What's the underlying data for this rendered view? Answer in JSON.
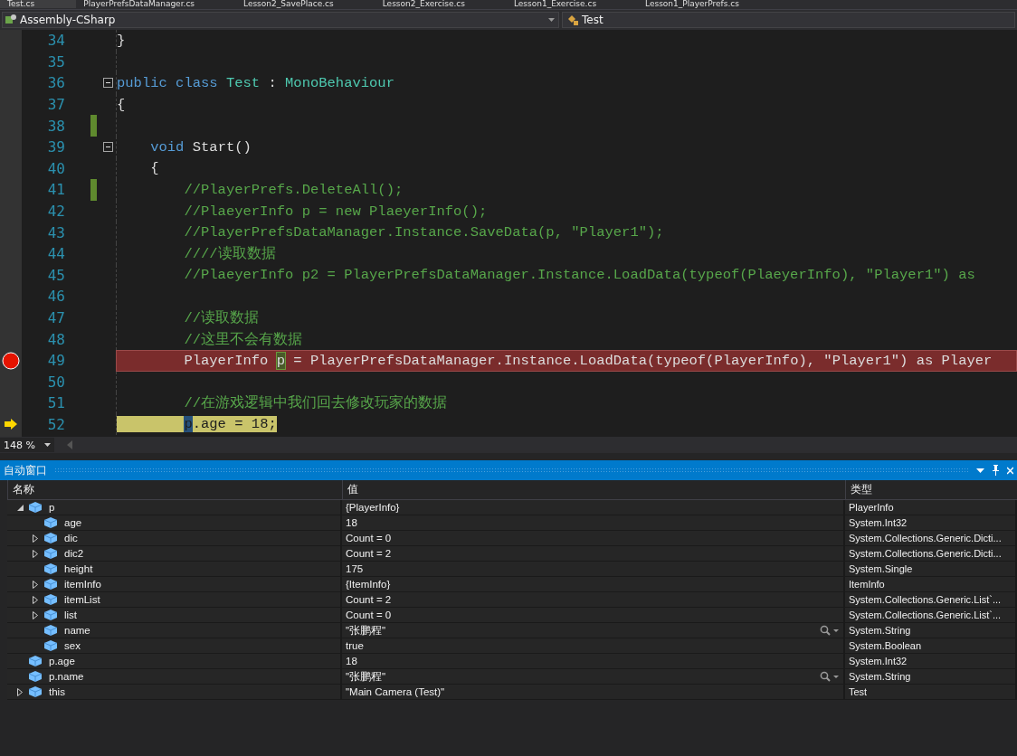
{
  "tabs": [
    {
      "label": "Test.cs",
      "selected": true
    },
    {
      "label": "PlayerPrefsDataManager.cs",
      "selected": false
    },
    {
      "label": "Lesson2_SavePlace.cs",
      "selected": false
    },
    {
      "label": "Lesson2_Exercise.cs",
      "selected": false
    },
    {
      "label": "Lesson1_Exercise.cs",
      "selected": false
    },
    {
      "label": "Lesson1_PlayerPrefs.cs",
      "selected": false
    }
  ],
  "navbar": {
    "project": "Assembly-CSharp",
    "class": "Test"
  },
  "editor": {
    "lines": [
      {
        "number": "34",
        "tokens": [
          {
            "kind": "plain",
            "text": "}"
          }
        ]
      },
      {
        "number": "35"
      },
      {
        "number": "36",
        "fold": true,
        "tokens": [
          {
            "kind": "keyword",
            "text": "public class"
          },
          {
            "kind": "type",
            "text": " Test"
          },
          {
            "kind": "plain",
            "text": " : "
          },
          {
            "kind": "type",
            "text": "MonoBehaviour"
          }
        ]
      },
      {
        "number": "37",
        "tokens": [
          {
            "kind": "plain",
            "text": "{"
          }
        ]
      },
      {
        "number": "38",
        "changed": true
      },
      {
        "number": "39",
        "fold": true,
        "tokens": [
          {
            "kind": "keyword",
            "text": "void"
          },
          {
            "kind": "plain",
            "text": " Start()"
          }
        ]
      },
      {
        "number": "40",
        "tokens": [
          {
            "kind": "plain",
            "text": "{"
          }
        ]
      },
      {
        "number": "41",
        "changed": true,
        "tokens": [
          {
            "kind": "comment",
            "text": "//PlayerPrefs.DeleteAll();"
          }
        ]
      },
      {
        "number": "42",
        "tokens": [
          {
            "kind": "comment",
            "text": "//PlaeyerInfo p = new PlaeyerInfo();"
          }
        ]
      },
      {
        "number": "43",
        "tokens": [
          {
            "kind": "comment",
            "text": "//PlayerPrefsDataManager.Instance.SaveData(p, \"Player1\");"
          }
        ]
      },
      {
        "number": "44",
        "tokens": [
          {
            "kind": "comment",
            "text": "////读取数据"
          }
        ]
      },
      {
        "number": "45",
        "tokens": [
          {
            "kind": "comment",
            "text": "//PlaeyerInfo p2 = PlayerPrefsDataManager.Instance.LoadData(typeof(PlaeyerInfo), \"Player1\") as"
          }
        ]
      },
      {
        "number": "46"
      },
      {
        "number": "47",
        "tokens": [
          {
            "kind": "comment",
            "text": "//读取数据"
          }
        ]
      },
      {
        "number": "48",
        "tokens": [
          {
            "kind": "comment",
            "text": "//这里不会有数据"
          }
        ]
      },
      {
        "number": "49",
        "breakpoint": true,
        "tokens": [
          {
            "kind": "plain",
            "text": "PlayerInfo "
          },
          {
            "kind": "reference",
            "text": "p"
          },
          {
            "kind": "plain",
            "text": " = PlayerPrefsDataManager.Instance.LoadData(typeof(PlayerInfo), \"Player1\") as Player"
          }
        ]
      },
      {
        "number": "50"
      },
      {
        "number": "51",
        "tokens": [
          {
            "kind": "comment",
            "text": "//在游戏逻辑中我们回去修改玩家的数据"
          }
        ]
      },
      {
        "number": "52",
        "current": true,
        "tokens": [
          {
            "kind": "selection",
            "text": "p"
          },
          {
            "kind": "plain",
            "text": ".age = 18;"
          }
        ]
      }
    ]
  },
  "status_bar": {
    "zoom": "148 %"
  },
  "autos": {
    "title": "自动窗口",
    "columns": [
      "名称",
      "值",
      "类型"
    ],
    "rows": [
      {
        "name": "p",
        "value": "{PlayerInfo}",
        "type": "PlayerInfo",
        "expanded": true,
        "children": [
          {
            "name": "age",
            "value": "18",
            "type": "System.Int32"
          },
          {
            "name": "dic",
            "value": "Count = 0",
            "type": "System.Collections.Generic.Dicti...",
            "expanded": false
          },
          {
            "name": "dic2",
            "value": "Count = 2",
            "type": "System.Collections.Generic.Dicti...",
            "expanded": false
          },
          {
            "name": "height",
            "value": "175",
            "type": "System.Single"
          },
          {
            "name": "itemInfo",
            "value": "{ItemInfo}",
            "type": "ItemInfo",
            "expanded": false
          },
          {
            "name": "itemList",
            "value": "Count = 2",
            "type": "System.Collections.Generic.List`...",
            "expanded": false
          },
          {
            "name": "list",
            "value": "Count = 0",
            "type": "System.Collections.Generic.List`...",
            "expanded": false
          },
          {
            "name": "name",
            "value": "\"张鹏程\"",
            "type": "System.String",
            "visualizer": true
          },
          {
            "name": "sex",
            "value": "true",
            "type": "System.Boolean"
          }
        ]
      },
      {
        "name": "p.age",
        "value": "18",
        "type": "System.Int32"
      },
      {
        "name": "p.name",
        "value": "\"张鹏程\"",
        "type": "System.String",
        "visualizer": true
      },
      {
        "name": "this",
        "value": "\"Main Camera (Test)\"",
        "type": "Test",
        "expanded": false
      }
    ]
  }
}
